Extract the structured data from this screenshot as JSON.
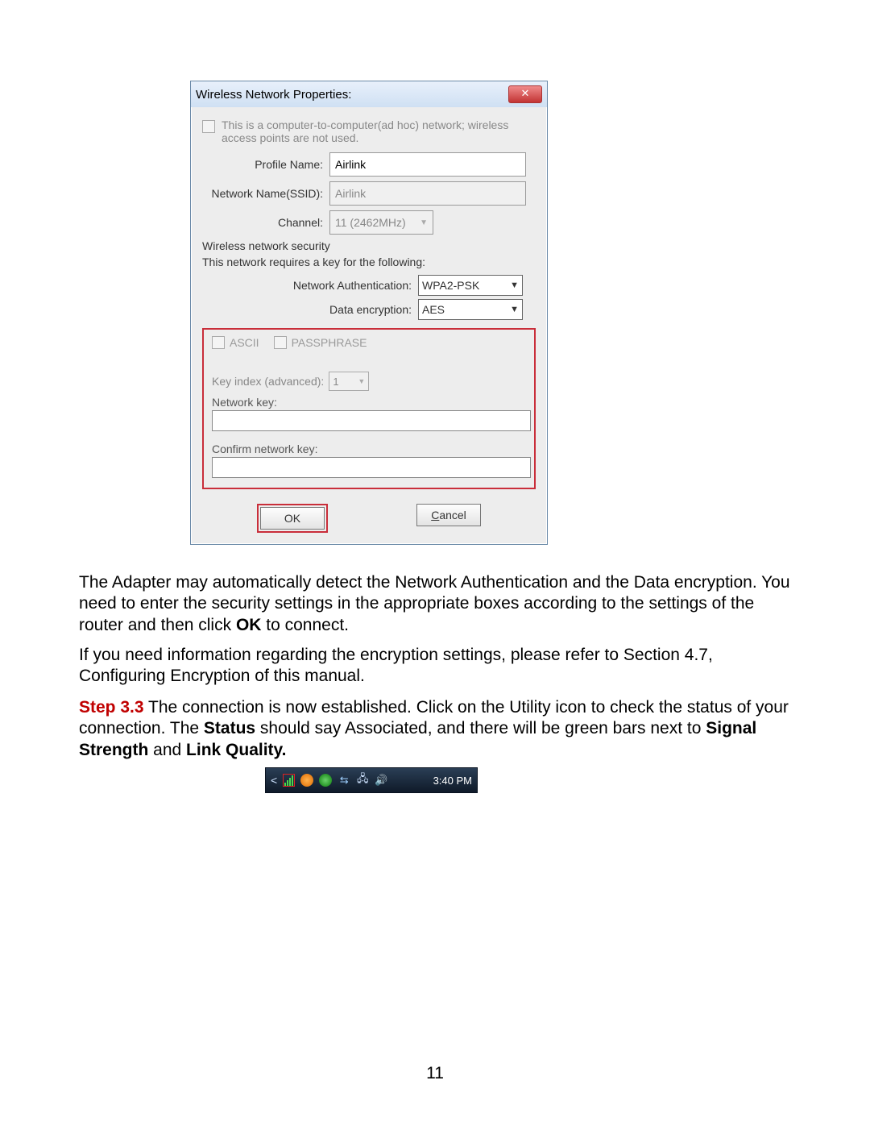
{
  "dialog": {
    "title": "Wireless Network Properties:",
    "close_glyph": "✕",
    "adhoc_text": "This is a computer-to-computer(ad hoc) network; wireless access points are not used.",
    "profile_label": "Profile Name:",
    "profile_value": "Airlink",
    "ssid_label": "Network Name(SSID):",
    "ssid_value": "Airlink",
    "channel_label": "Channel:",
    "channel_value": "11 (2462MHz)",
    "sec_header": "Wireless network security",
    "sec_sub": "This network requires a key for the following:",
    "auth_label": "Network Authentication:",
    "auth_value": "WPA2-PSK",
    "enc_label": "Data encryption:",
    "enc_value": "AES",
    "ascii_label": "ASCII",
    "pass_label": "PASSPHRASE",
    "key_index_label": "Key index (advanced):",
    "key_index_value": "1",
    "network_key_label": "Network key:",
    "confirm_key_label": "Confirm network key:",
    "ok_label": "OK",
    "cancel_first": "C",
    "cancel_rest": "ancel"
  },
  "para1_a": "The Adapter may automatically detect the Network Authentication and the Data encryption. You need to enter the security settings in the appropriate boxes according to the settings of the router and then click ",
  "para1_b": "OK",
  "para1_c": " to connect.",
  "para2": "If you need information regarding the encryption settings, please refer to Section 4.7, Configuring Encryption of this manual.",
  "step_label": "Step 3.3",
  "para3_a": " The connection is now established.  Click on the Utility icon to check the status of your connection.  The ",
  "para3_b": "Status",
  "para3_c": " should say Associated, and there will be green bars next to ",
  "para3_d": "Signal Strength",
  "para3_e": " and ",
  "para3_f": "Link Quality.",
  "tray": {
    "time": "3:40 PM"
  },
  "page_number": "11"
}
